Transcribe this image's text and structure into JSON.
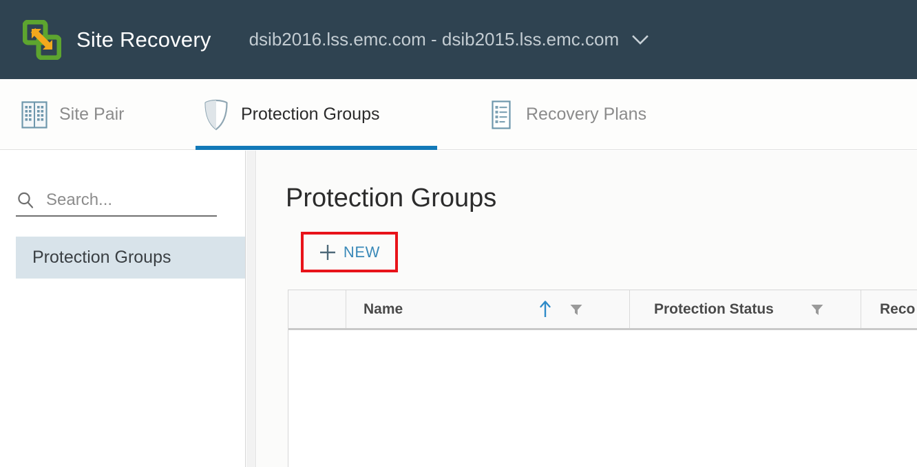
{
  "header": {
    "logo_icon": "site-recovery-logo-icon",
    "title": "Site Recovery",
    "site_pair": "dsib2016.lss.emc.com - dsib2015.lss.emc.com",
    "caret_icon": "chevron-down-icon",
    "background_color": "#2F4351",
    "title_color": "#FFFFFF",
    "site_pair_color": "#C3CCD2"
  },
  "nav": {
    "tabs": [
      {
        "id": "site-pair",
        "label": "Site Pair",
        "icon": "buildings-icon",
        "active": false
      },
      {
        "id": "protection-groups",
        "label": "Protection Groups",
        "icon": "shield-icon",
        "active": true
      },
      {
        "id": "recovery-plans",
        "label": "Recovery Plans",
        "icon": "document-list-icon",
        "active": false
      }
    ],
    "active_underline_color": "#1279B8"
  },
  "sidebar": {
    "search": {
      "icon": "search-icon",
      "value": "",
      "placeholder": "Search..."
    },
    "items": [
      {
        "label": "Protection Groups",
        "selected": true
      }
    ],
    "selected_background": "#D8E3EA"
  },
  "main": {
    "page_title": "Protection Groups",
    "new_button": {
      "icon": "plus-icon",
      "label": "NEW",
      "label_color": "#3A89B8",
      "highlight_border_color": "#E8131A"
    },
    "table": {
      "columns": [
        {
          "key": "select",
          "label": "",
          "sort_icon": "",
          "filter_icon": ""
        },
        {
          "key": "name",
          "label": "Name",
          "sort_icon": "sort-ascending-icon",
          "filter_icon": "filter-funnel-icon"
        },
        {
          "key": "protection_status",
          "label": "Protection Status",
          "sort_icon": "",
          "filter_icon": "filter-funnel-icon"
        },
        {
          "key": "recovery_plan",
          "label": "Reco",
          "sort_icon": "",
          "filter_icon": ""
        }
      ],
      "rows": [],
      "sort_icon_color": "#2E8BC8",
      "filter_icon_color": "#9A9A9A"
    }
  }
}
